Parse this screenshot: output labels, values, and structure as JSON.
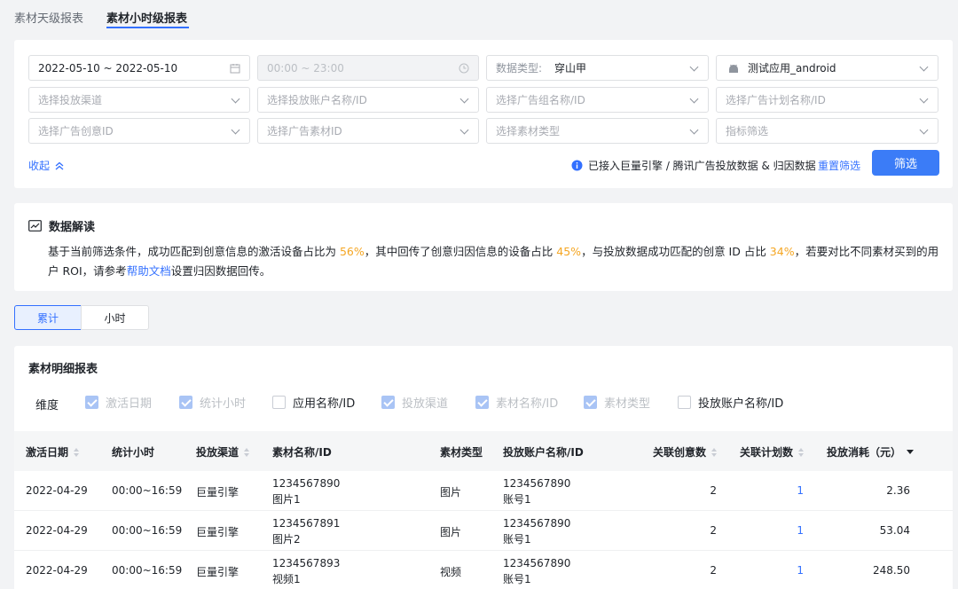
{
  "tabs": [
    {
      "label": "素材天级报表",
      "active": false
    },
    {
      "label": "素材小时级报表",
      "active": true
    }
  ],
  "filters": {
    "date_range": "2022-05-10 ~ 2022-05-10",
    "time_range": "00:00 ~ 23:00",
    "data_type_label": "数据类型:",
    "data_type_value": "穿山甲",
    "app_value": "测试应用_android",
    "row2": [
      "选择投放渠道",
      "选择投放账户名称/ID",
      "选择广告组名称/ID",
      "选择广告计划名称/ID"
    ],
    "row3": [
      "选择广告创意ID",
      "选择广告素材ID",
      "选择素材类型",
      "指标筛选"
    ],
    "collapse_label": "收起",
    "notice": "已接入巨量引擎 / 腾讯广告投放数据 & 归因数据",
    "reset_label": "重置筛选",
    "submit_label": "筛选"
  },
  "insight": {
    "title": "数据解读",
    "text_1": "基于当前筛选条件，成功匹配到创意信息的激活设备占比为 ",
    "pct_1": "56%",
    "text_2": "，其中回传了创意归因信息的设备占比 ",
    "pct_2": "45%",
    "text_3": "，与投放数据成功匹配的创意 ID 占比 ",
    "pct_3": "34%",
    "text_4": "，若要对比不同素材买到的用户 ROI，请参考",
    "link": "帮助文档",
    "text_5": "设置归因数据回传。"
  },
  "view_toggle": {
    "cumulative": "累计",
    "hourly": "小时"
  },
  "report": {
    "title": "素材明细报表",
    "dimension_label": "维度",
    "dimensions": [
      {
        "label": "激活日期",
        "checked": true,
        "disabled": true
      },
      {
        "label": "统计小时",
        "checked": true,
        "disabled": true
      },
      {
        "label": "应用名称/ID",
        "checked": false,
        "disabled": false
      },
      {
        "label": "投放渠道",
        "checked": true,
        "disabled": true
      },
      {
        "label": "素材名称/ID",
        "checked": true,
        "disabled": true
      },
      {
        "label": "素材类型",
        "checked": true,
        "disabled": true
      },
      {
        "label": "投放账户名称/ID",
        "checked": false,
        "disabled": false
      }
    ],
    "columns": [
      "激活日期",
      "统计小时",
      "投放渠道",
      "素材名称/ID",
      "素材类型",
      "投放账户名称/ID",
      "关联创意数",
      "关联计划数",
      "投放消耗（元）"
    ],
    "rows": [
      {
        "date": "2022-04-29",
        "hour": "00:00~16:59",
        "channel": "巨量引擎",
        "material_id": "1234567890",
        "material_name": "图片1",
        "type": "图片",
        "account_id": "1234567890",
        "account_name": "账号1",
        "creatives": "2",
        "plans": "1",
        "cost": "2.36"
      },
      {
        "date": "2022-04-29",
        "hour": "00:00~16:59",
        "channel": "巨量引擎",
        "material_id": "1234567891",
        "material_name": "图片2",
        "type": "图片",
        "account_id": "1234567890",
        "account_name": "账号1",
        "creatives": "2",
        "plans": "1",
        "cost": "53.04"
      },
      {
        "date": "2022-04-29",
        "hour": "00:00~16:59",
        "channel": "巨量引擎",
        "material_id": "1234567893",
        "material_name": "视频1",
        "type": "视频",
        "account_id": "1234567890",
        "account_name": "账号1",
        "creatives": "2",
        "plans": "1",
        "cost": "248.50"
      }
    ]
  },
  "colors": {
    "accent": "#3370ff",
    "highlight": "#f5a623",
    "button": "#3b7cf7"
  }
}
